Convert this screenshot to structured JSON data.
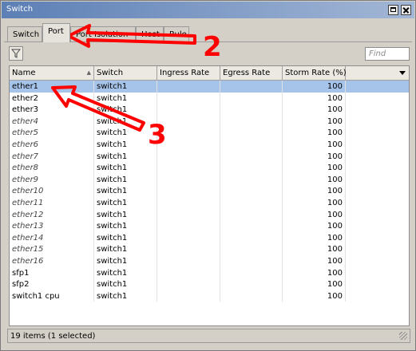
{
  "window": {
    "title": "Switch"
  },
  "tabs": [
    {
      "label": "Switch",
      "active": false
    },
    {
      "label": "Port",
      "active": true
    },
    {
      "label": "Port Isolation",
      "active": false
    },
    {
      "label": "Host",
      "active": false
    },
    {
      "label": "Rule",
      "active": false
    }
  ],
  "toolbar": {
    "filter_icon": "filter-icon",
    "find_placeholder": "Find"
  },
  "table": {
    "columns": [
      "Name",
      "Switch",
      "Ingress Rate",
      "Egress Rate",
      "Storm Rate (%)"
    ],
    "rows": [
      {
        "name": "ether1",
        "switch": "switch1",
        "ingress": "",
        "egress": "",
        "storm": "100",
        "selected": true,
        "disabled": false
      },
      {
        "name": "ether2",
        "switch": "switch1",
        "ingress": "",
        "egress": "",
        "storm": "100",
        "selected": false,
        "disabled": false
      },
      {
        "name": "ether3",
        "switch": "switch1",
        "ingress": "",
        "egress": "",
        "storm": "100",
        "selected": false,
        "disabled": false
      },
      {
        "name": "ether4",
        "switch": "switch1",
        "ingress": "",
        "egress": "",
        "storm": "100",
        "selected": false,
        "disabled": true
      },
      {
        "name": "ether5",
        "switch": "switch1",
        "ingress": "",
        "egress": "",
        "storm": "100",
        "selected": false,
        "disabled": true
      },
      {
        "name": "ether6",
        "switch": "switch1",
        "ingress": "",
        "egress": "",
        "storm": "100",
        "selected": false,
        "disabled": true
      },
      {
        "name": "ether7",
        "switch": "switch1",
        "ingress": "",
        "egress": "",
        "storm": "100",
        "selected": false,
        "disabled": true
      },
      {
        "name": "ether8",
        "switch": "switch1",
        "ingress": "",
        "egress": "",
        "storm": "100",
        "selected": false,
        "disabled": true
      },
      {
        "name": "ether9",
        "switch": "switch1",
        "ingress": "",
        "egress": "",
        "storm": "100",
        "selected": false,
        "disabled": true
      },
      {
        "name": "ether10",
        "switch": "switch1",
        "ingress": "",
        "egress": "",
        "storm": "100",
        "selected": false,
        "disabled": true
      },
      {
        "name": "ether11",
        "switch": "switch1",
        "ingress": "",
        "egress": "",
        "storm": "100",
        "selected": false,
        "disabled": true
      },
      {
        "name": "ether12",
        "switch": "switch1",
        "ingress": "",
        "egress": "",
        "storm": "100",
        "selected": false,
        "disabled": true
      },
      {
        "name": "ether13",
        "switch": "switch1",
        "ingress": "",
        "egress": "",
        "storm": "100",
        "selected": false,
        "disabled": true
      },
      {
        "name": "ether14",
        "switch": "switch1",
        "ingress": "",
        "egress": "",
        "storm": "100",
        "selected": false,
        "disabled": true
      },
      {
        "name": "ether15",
        "switch": "switch1",
        "ingress": "",
        "egress": "",
        "storm": "100",
        "selected": false,
        "disabled": true
      },
      {
        "name": "ether16",
        "switch": "switch1",
        "ingress": "",
        "egress": "",
        "storm": "100",
        "selected": false,
        "disabled": true
      },
      {
        "name": "sfp1",
        "switch": "switch1",
        "ingress": "",
        "egress": "",
        "storm": "100",
        "selected": false,
        "disabled": false
      },
      {
        "name": "sfp2",
        "switch": "switch1",
        "ingress": "",
        "egress": "",
        "storm": "100",
        "selected": false,
        "disabled": false
      },
      {
        "name": "switch1 cpu",
        "switch": "switch1",
        "ingress": "",
        "egress": "",
        "storm": "100",
        "selected": false,
        "disabled": false
      }
    ]
  },
  "status": {
    "text": "19 items (1 selected)"
  },
  "annotations": [
    {
      "label": "2",
      "color": "#ff0000"
    },
    {
      "label": "3",
      "color": "#ff0000"
    }
  ],
  "colors": {
    "selection": "#a6c3ea",
    "titlebar": "#5c7fb5",
    "annotation": "#ff0000"
  }
}
